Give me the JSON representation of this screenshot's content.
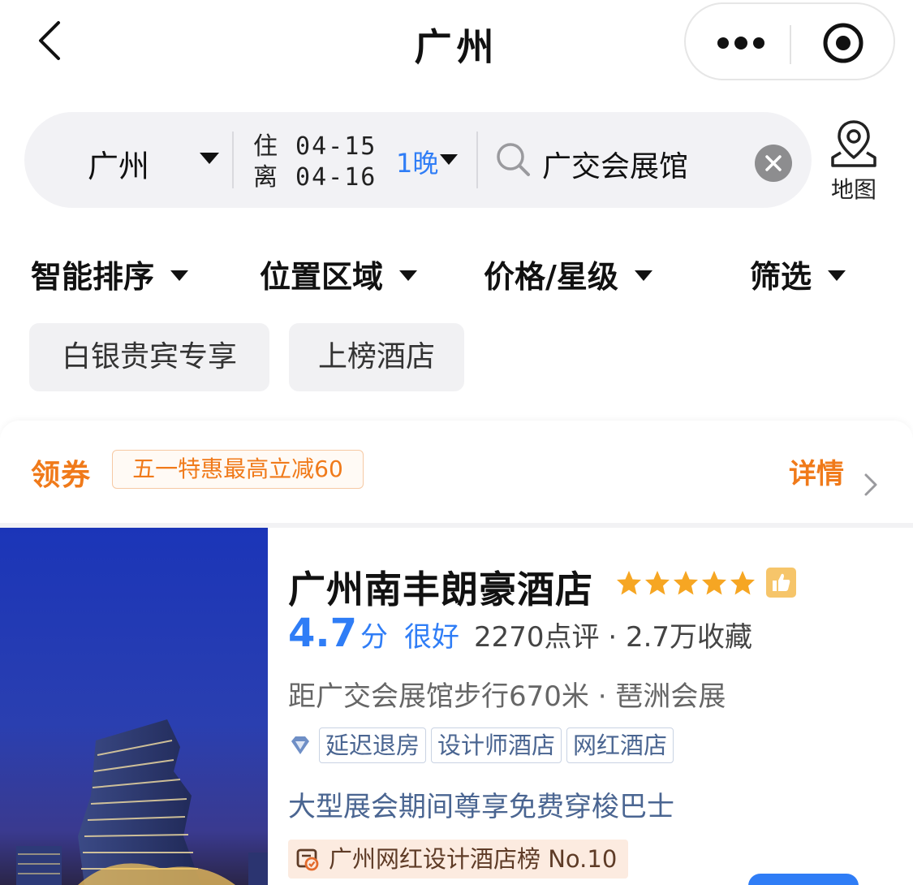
{
  "nav": {
    "title": "广州",
    "back_icon": "chevron-left-icon",
    "more_icon": "more-dots-icon",
    "close_icon": "target-circle-icon"
  },
  "search": {
    "city": "广州",
    "checkin_label": "住 04-15",
    "checkout_label": "离 04-16",
    "nights": "1晚",
    "keyword": "广交会展馆",
    "map_label": "地图"
  },
  "sort": {
    "items": [
      {
        "label": "智能排序"
      },
      {
        "label": "位置区域"
      },
      {
        "label": "价格/星级"
      },
      {
        "label": "筛选"
      }
    ]
  },
  "tags": [
    {
      "label": "白银贵宾专享"
    },
    {
      "label": "上榜酒店"
    }
  ],
  "coupon": {
    "title": "领券",
    "badge": "五一特惠最高立减60",
    "detail": "详情"
  },
  "hotel": {
    "name": "广州南丰朗豪酒店",
    "star_count": 5,
    "score": "4.7",
    "score_unit": "分",
    "score_word": "很好",
    "reviews": "2270点评 · 2.7万收藏",
    "distance": "距广交会展馆步行670米 · 琶洲会展",
    "amenities": [
      "延迟退房",
      "设计师酒店",
      "网红酒店"
    ],
    "promo": "大型展会期间尊享免费穿梭巴士",
    "rank": "广州网红设计酒店榜 No.10"
  },
  "colors": {
    "accent_blue": "#2f7df6",
    "coupon_orange": "#f07a1a",
    "star_orange": "#f6a623",
    "tag_blue": "#4a6591"
  }
}
